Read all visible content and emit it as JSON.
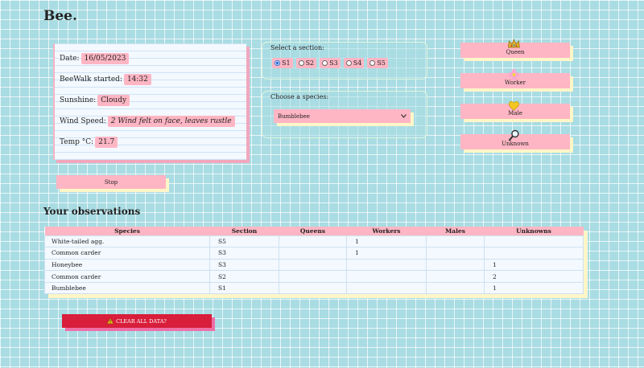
{
  "app": {
    "title": "Bee."
  },
  "log": {
    "date_label": "Date:",
    "date_value": "16/05/2023",
    "started_label": "BeeWalk started:",
    "started_value": "14:32",
    "sunshine_label": "Sunshine:",
    "sunshine_value": "Cloudy",
    "wind_label": "Wind Speed:",
    "wind_value": "2 Wind felt on face, leaves rustle",
    "temp_label": "Temp °C:",
    "temp_value": "21.7"
  },
  "controls": {
    "stop_label": "Stop"
  },
  "section": {
    "label": "Select a section:",
    "options": [
      "S1",
      "S2",
      "S3",
      "S4",
      "S5"
    ],
    "selected": "S1"
  },
  "species": {
    "label": "Choose a species:",
    "selected": "Bumblebee"
  },
  "castes": [
    {
      "label": "Queen",
      "icon": "crown-icon"
    },
    {
      "label": "Worker",
      "icon": "flower-icon"
    },
    {
      "label": "Male",
      "icon": "heart-icon"
    },
    {
      "label": "Unknown",
      "icon": "magnifier-icon"
    }
  ],
  "observations": {
    "heading": "Your observations",
    "columns": [
      "Species",
      "Section",
      "Queens",
      "Workers",
      "Males",
      "Unknowns"
    ],
    "rows": [
      [
        "White-tailed agg.",
        "S5",
        "",
        "1",
        "",
        ""
      ],
      [
        "Common carder",
        "S3",
        "",
        "1",
        "",
        ""
      ],
      [
        "Honeybee",
        "S3",
        "",
        "",
        "",
        "1"
      ],
      [
        "Common carder",
        "S2",
        "",
        "",
        "",
        "2"
      ],
      [
        "Bumblebee",
        "S1",
        "",
        "",
        "",
        "1"
      ]
    ]
  },
  "clear": {
    "label": "CLEAR ALL DATA?",
    "icon": "warning-icon"
  },
  "colors": {
    "pink": "#ffb6c4",
    "danger": "#d81e3a",
    "background": "#a9dce3",
    "cream": "#fff6c8"
  }
}
